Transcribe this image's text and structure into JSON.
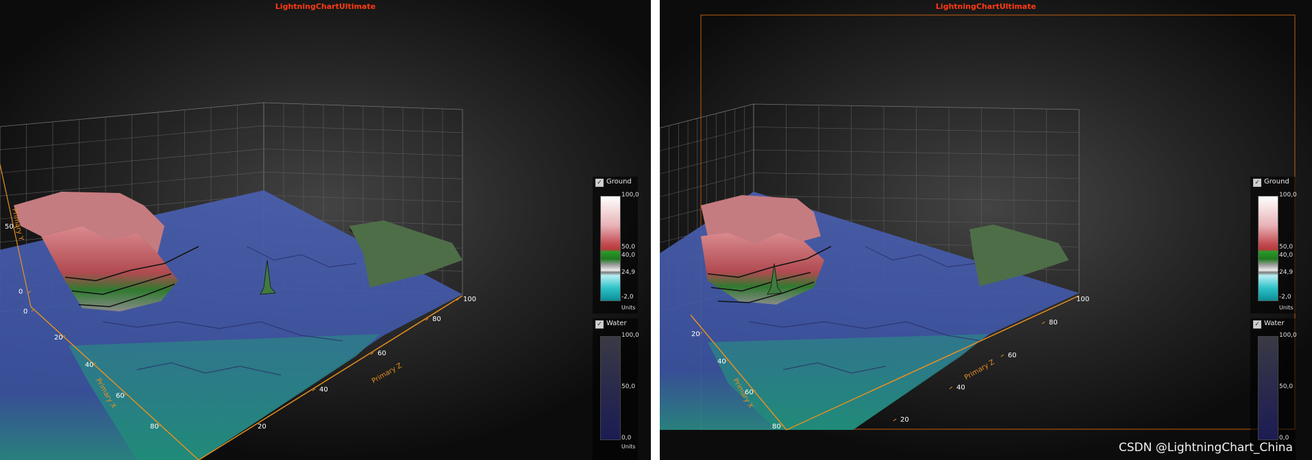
{
  "panels": [
    {
      "title": "LightningChartUltimate"
    },
    {
      "title": "LightningChartUltimate"
    }
  ],
  "watermark": "CSDN @LightningChart_China",
  "chart_data": [
    {
      "type": "surface3d",
      "title": "LightningChartUltimate",
      "axes": {
        "x": {
          "label": "Primary X",
          "range": [
            0,
            100
          ],
          "ticks": [
            "0",
            "20",
            "40",
            "60",
            "80"
          ]
        },
        "y": {
          "label": "Primary Y",
          "ticks": [
            "0",
            "50"
          ]
        },
        "z": {
          "label": "Primary Z",
          "range": [
            0,
            100
          ],
          "ticks": [
            "20",
            "40",
            "60",
            "80",
            "100"
          ]
        }
      },
      "grid": true,
      "legend_position": "right",
      "series": [
        {
          "name": "Ground",
          "checked": true,
          "palette_min": -2.0,
          "palette_max": 100.0,
          "palette_ticks": [
            "100,0",
            "50,0",
            "40,0",
            "24,9",
            "-2,0"
          ],
          "unit": "Units",
          "palette": [
            "#18b4bc",
            "#8fe0e6",
            "#9a9a9a",
            "#2a8a2a",
            "#c8484f",
            "#ffffff"
          ]
        },
        {
          "name": "Water",
          "checked": true,
          "palette_min": 0.0,
          "palette_max": 100.0,
          "palette_ticks": [
            "100,0",
            "50,0",
            "0,0"
          ],
          "unit": "Units",
          "palette": [
            "#1e1e52",
            "#383848"
          ]
        }
      ]
    },
    {
      "type": "surface3d",
      "title": "LightningChartUltimate",
      "axes": {
        "x": {
          "label": "Primary X",
          "range": [
            0,
            100
          ],
          "ticks": [
            "20",
            "40",
            "60",
            "80"
          ]
        },
        "z": {
          "label": "Primary Z",
          "range": [
            0,
            100
          ],
          "ticks": [
            "20",
            "40",
            "60",
            "80",
            "100"
          ]
        }
      },
      "grid": true,
      "legend_position": "right",
      "series": [
        {
          "name": "Ground",
          "checked": true,
          "palette_min": -2.0,
          "palette_max": 100.0,
          "palette_ticks": [
            "100,0",
            "50,0",
            "40,0",
            "24,9",
            "-2,0"
          ],
          "unit": "Units",
          "palette": [
            "#18b4bc",
            "#8fe0e6",
            "#9a9a9a",
            "#2a8a2a",
            "#c8484f",
            "#ffffff"
          ]
        },
        {
          "name": "Water",
          "checked": true,
          "palette_min": 0.0,
          "palette_max": 100.0,
          "palette_ticks": [
            "100,0",
            "50,0",
            "0,0"
          ],
          "unit": "Units",
          "palette": [
            "#1e1e52",
            "#383848"
          ]
        }
      ]
    }
  ]
}
